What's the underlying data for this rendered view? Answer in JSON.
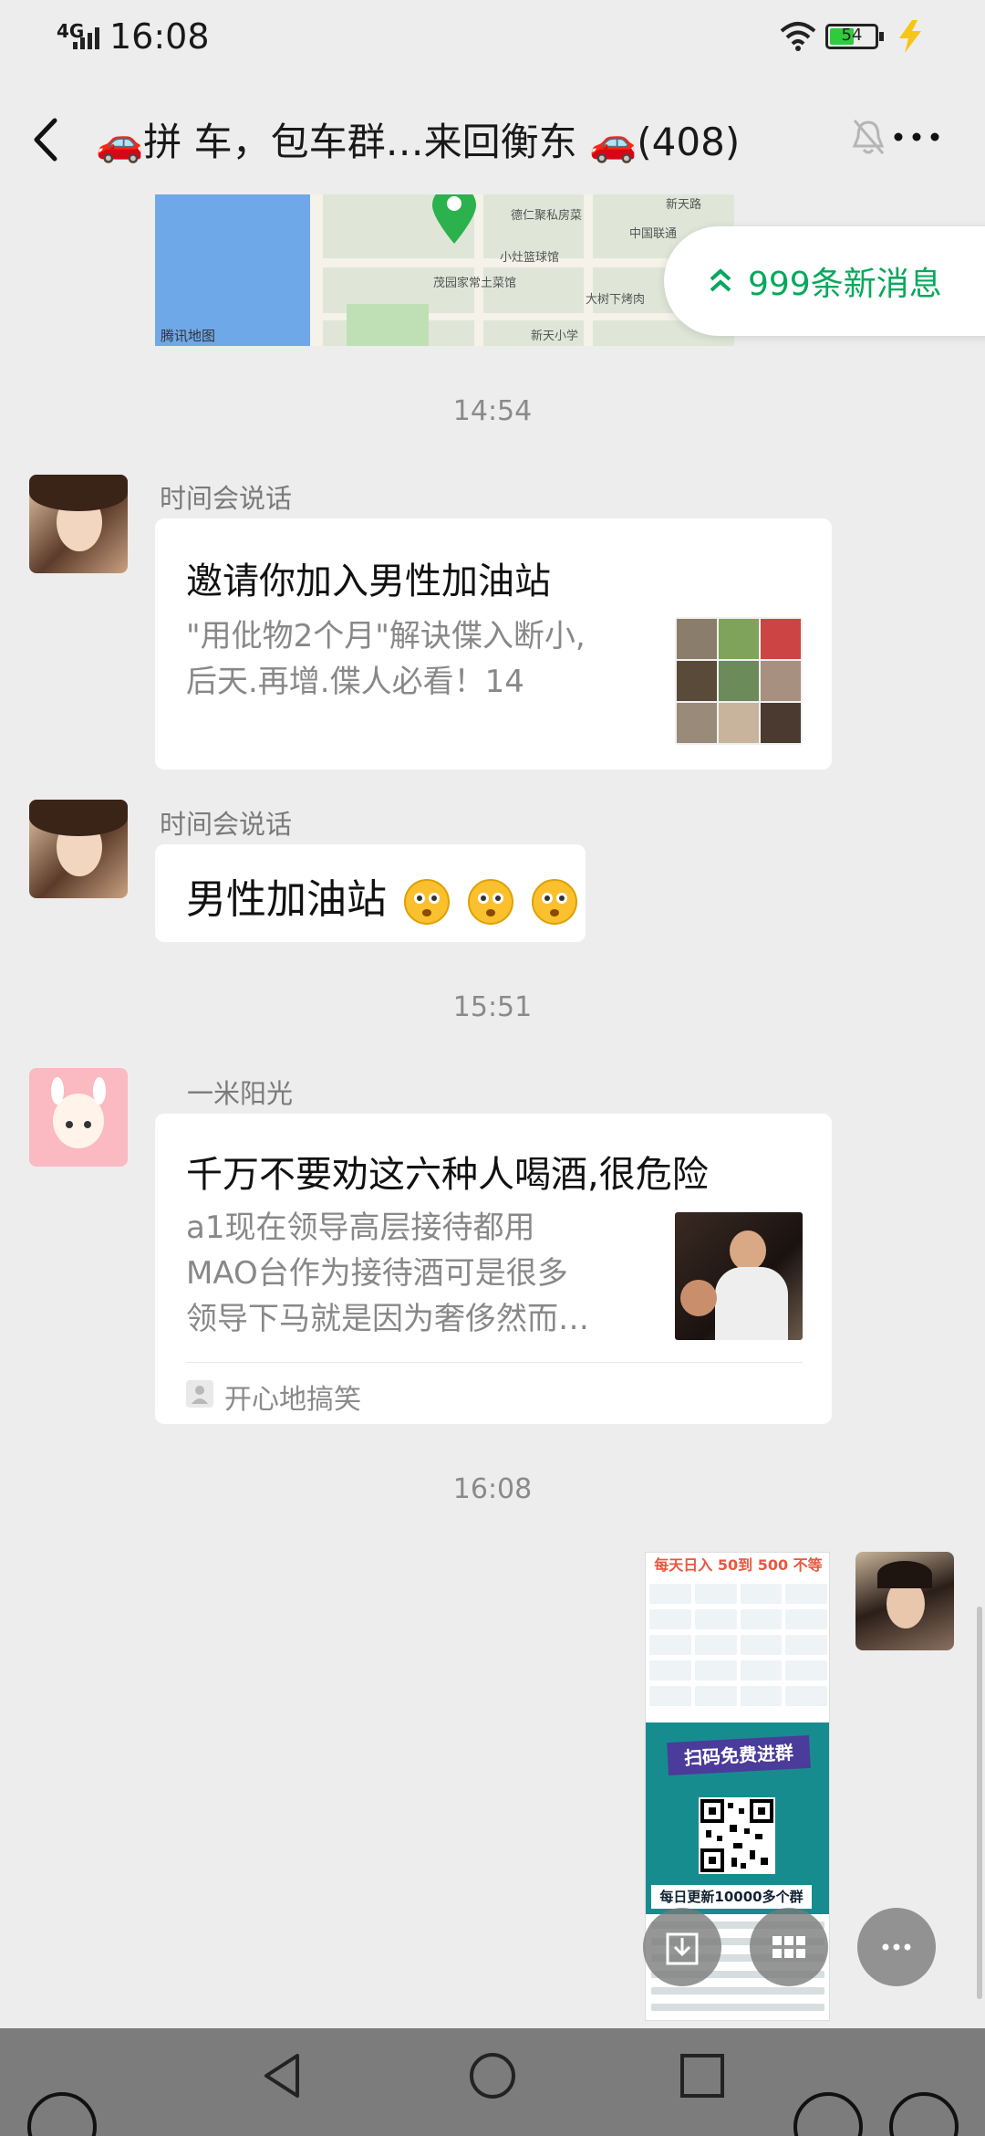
{
  "status_bar": {
    "network": "4G",
    "time": "16:08",
    "battery_level": "54",
    "battery_fraction": 0.54
  },
  "header": {
    "title": "🚗拼 车，包车群…来回衡东 🚗(408)"
  },
  "map": {
    "provider": "腾讯地图",
    "labels": [
      "德仁聚私房菜",
      "中国联通",
      "小灶篮球馆",
      "茂园家常土菜馆",
      "大树下烤肉",
      "新天小学",
      "新天路"
    ]
  },
  "new_messages": {
    "label": "999条新消息"
  },
  "messages": {
    "ts1": "14:54",
    "m1": {
      "sender": "时间会说话",
      "title": "邀请你加入男性加油站",
      "desc_line1": "\"用仳物2个月\"解诀偞入断小,",
      "desc_line2": "后天.再增.偞人必看！14"
    },
    "m2": {
      "sender": "时间会说话",
      "text": "男性加油站"
    },
    "ts2": "15:51",
    "m3": {
      "sender": "一米阳光",
      "title": "千万不要劝这六种人喝酒,很危险",
      "desc_line1": "a1现在领导高层接待都用",
      "desc_line2": "MAO台作为接待酒可是很多",
      "desc_line3": "领导下马就是因为奢侈然而…",
      "source": "开心地搞笑"
    },
    "ts3": "16:08",
    "m4": {
      "poster_head": "每天日入 50到 500 不等",
      "poster_banner": "扫码免费进群",
      "poster_update": "每日更新10000多个群"
    }
  }
}
